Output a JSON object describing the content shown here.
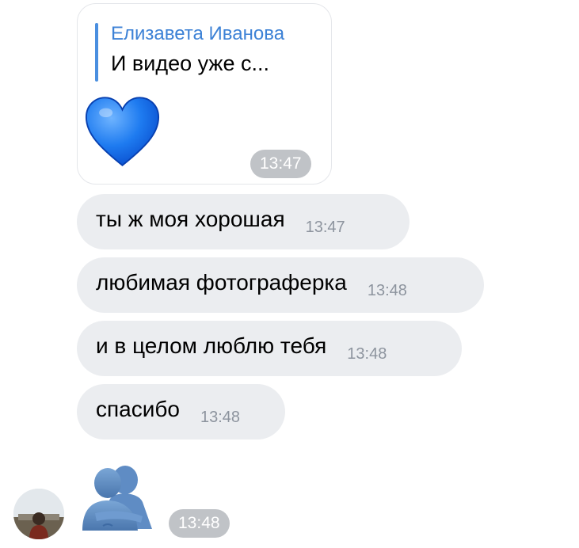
{
  "reply": {
    "author": "Елизавета Иванова",
    "text": "И видео уже с...",
    "sticker_icon": "blue-heart-icon",
    "time": "13:47"
  },
  "messages": [
    {
      "text": "ты ж моя хорошая",
      "time": "13:47"
    },
    {
      "text": "любимая фотограферка",
      "time": "13:48"
    },
    {
      "text": "и в целом люблю тебя",
      "time": "13:48"
    },
    {
      "text": "спасибо",
      "time": "13:48"
    }
  ],
  "last_sticker": {
    "sticker_icon": "hugging-people-icon",
    "time": "13:48"
  },
  "colors": {
    "accent": "#3d82d6",
    "bubble": "#ebedf0",
    "time_gray": "#8d949e"
  }
}
